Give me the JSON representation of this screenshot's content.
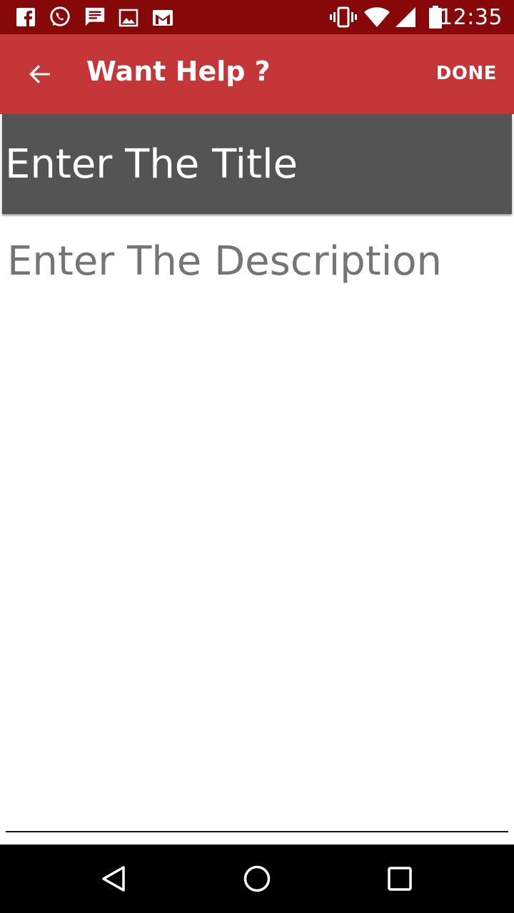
{
  "status_bar": {
    "time": "12:35",
    "left_icons": [
      "facebook-icon",
      "whatsapp-icon",
      "message-icon",
      "image-icon",
      "gmail-icon"
    ],
    "right_icons": [
      "vibrate-icon",
      "wifi-icon",
      "signal-icon",
      "battery-icon"
    ]
  },
  "app_bar": {
    "title": "Want Help ?",
    "action_label": "DONE",
    "color": "#c43637",
    "status_color": "#860809"
  },
  "form": {
    "title_placeholder": "Enter The Title",
    "title_value": "",
    "description_placeholder": "Enter The Description",
    "description_value": ""
  },
  "nav_bar": {
    "buttons": [
      "back-triangle-icon",
      "home-circle-icon",
      "recents-square-icon"
    ]
  }
}
